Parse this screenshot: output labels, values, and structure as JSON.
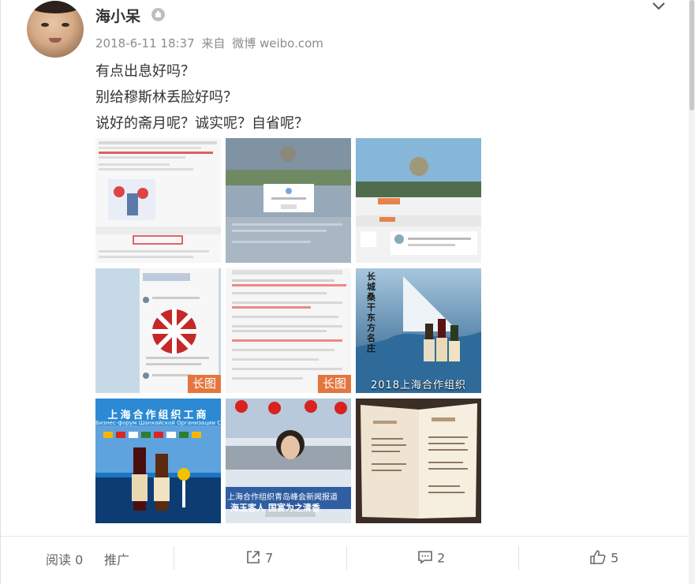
{
  "post": {
    "author": "海小呆",
    "timestamp": "2018-6-11 18:37",
    "source_prefix": "来自",
    "source": "微博 weibo.com",
    "lines": [
      "有点出息好吗？",
      "别给穆斯林丢脸好吗？",
      "说好的斋月呢？诚实呢？自省呢？"
    ]
  },
  "images": {
    "long_badge": "长图",
    "caption_6": "2018上海合作组织",
    "vertical_label_6": "长城桑干 东方名庄",
    "banner_7": "上海合作组织工商",
    "banner_7_sub": "Бизнес-форум Шанхайской Организации Сотру",
    "banner_8_line1": "上海合作组织青岛峰会新闻报道",
    "banner_8_line2": "海玉客人 国宴为之清香"
  },
  "footer": {
    "read_label": "阅读",
    "read_count": "0",
    "promote_label": "推广",
    "share_count": "7",
    "comment_count": "2",
    "like_count": "5"
  },
  "colors": {
    "badge": "#e3763f",
    "text_main": "#333333",
    "text_meta": "#8c8c8c"
  }
}
